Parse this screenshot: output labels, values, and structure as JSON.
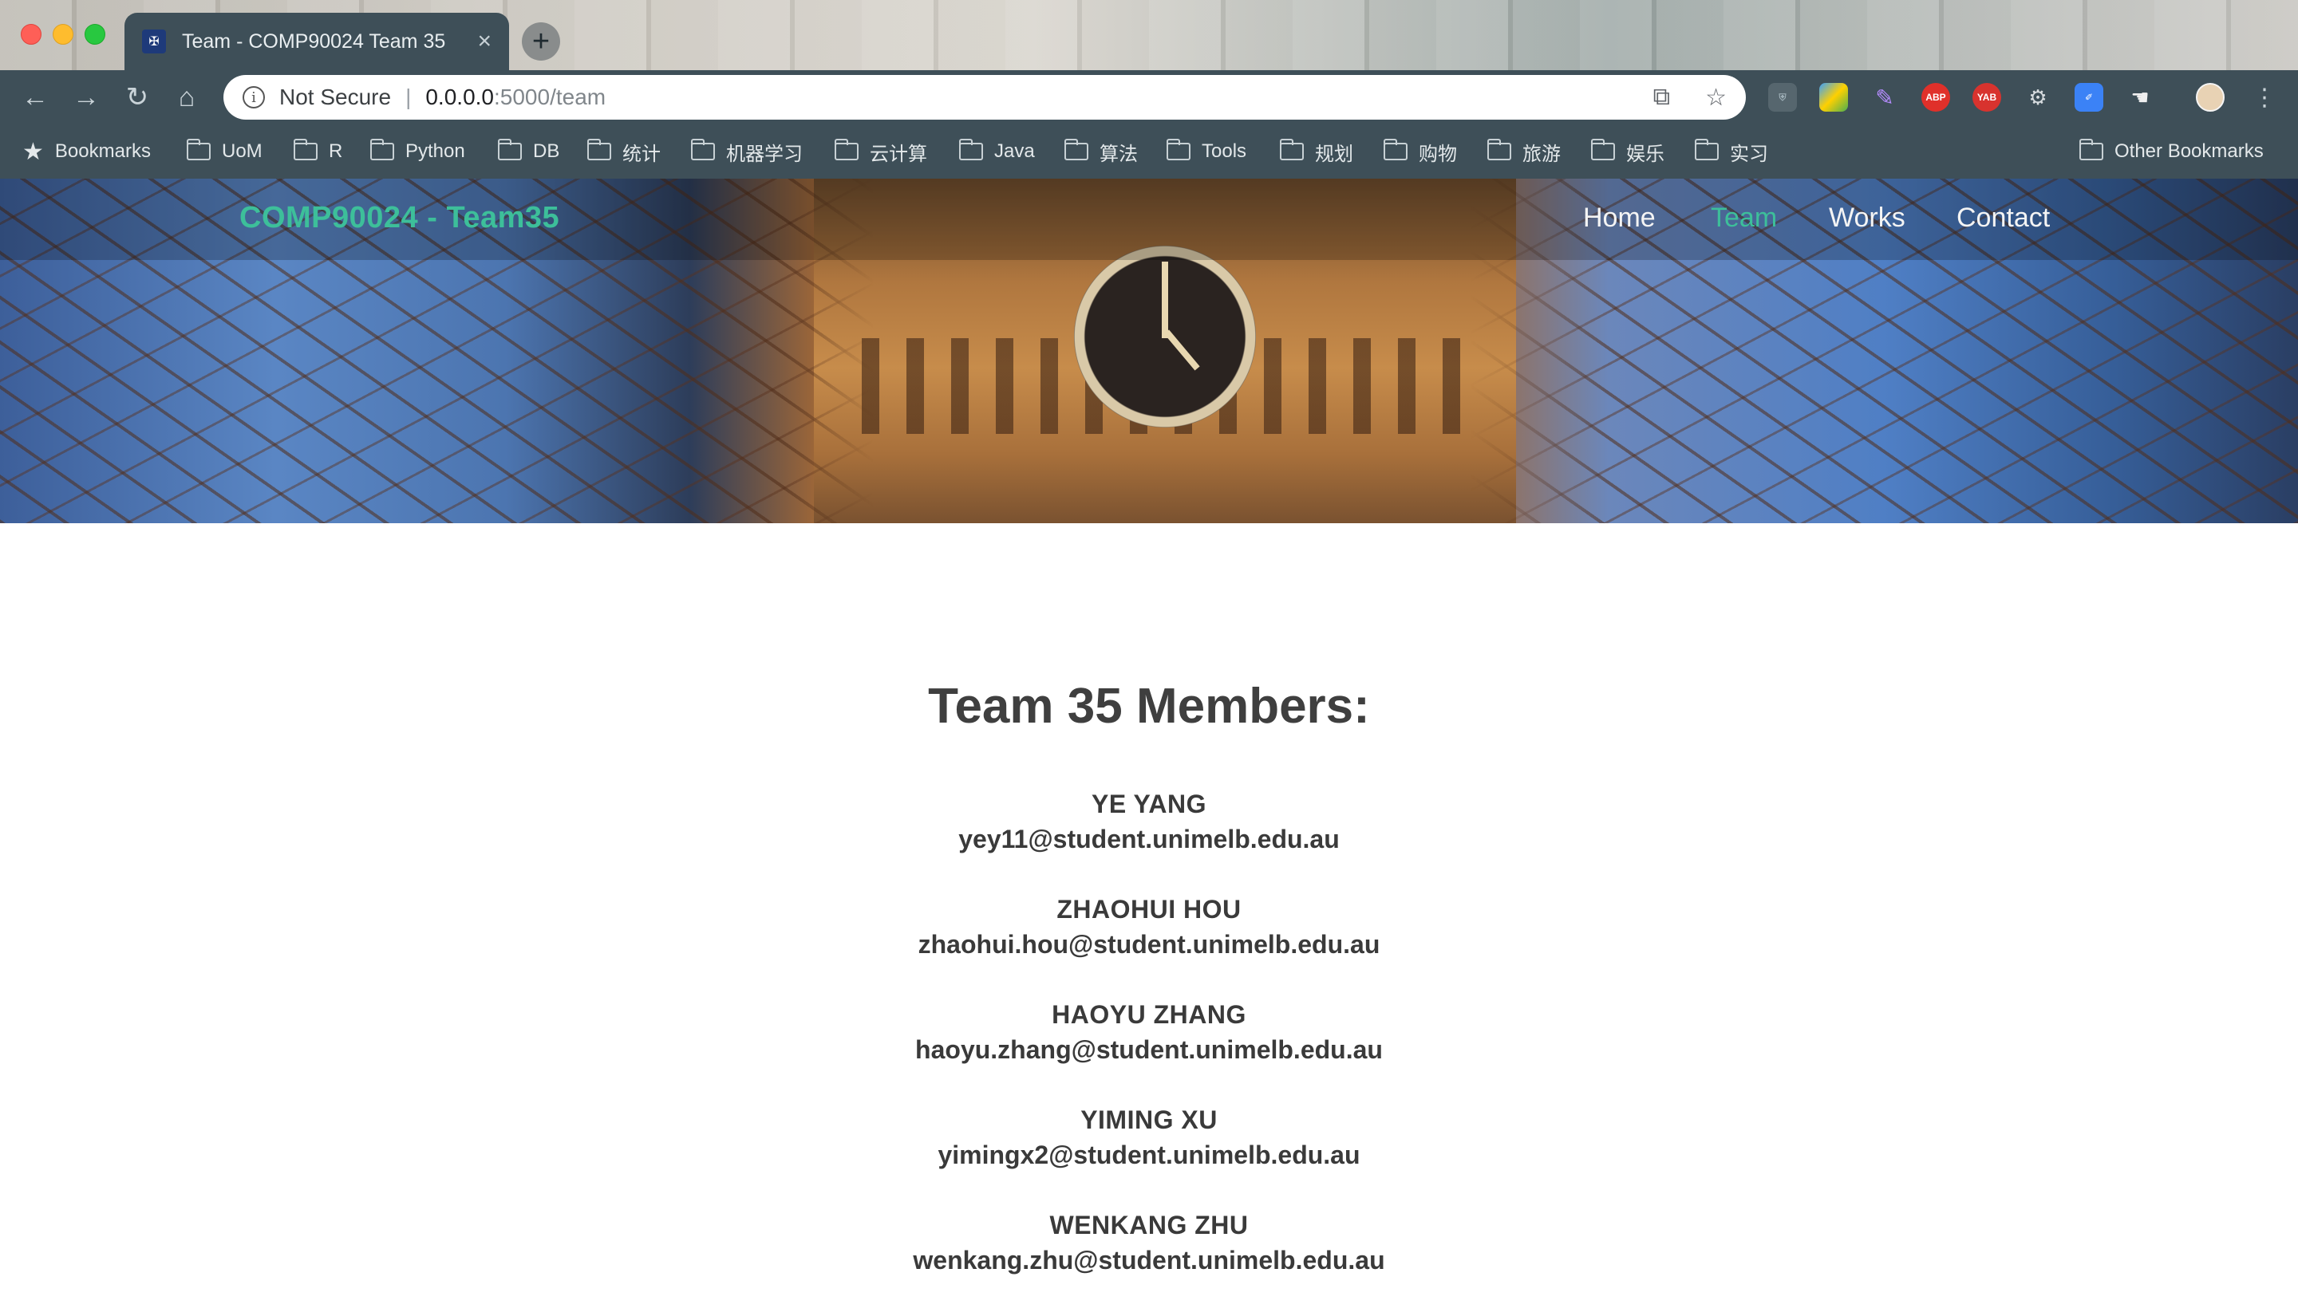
{
  "browser": {
    "tab_title": "Team - COMP90024 Team 35",
    "tab_favicon": "university-crest-icon",
    "url_security": "Not Secure",
    "url_host": "0.0.0.0",
    "url_path": ":5000/team",
    "extensions": [
      {
        "name": "shield-extension-icon",
        "label": ""
      },
      {
        "name": "colorful-extension-icon",
        "label": ""
      },
      {
        "name": "feather-extension-icon",
        "label": ""
      },
      {
        "name": "adblock-plus-icon",
        "label": "ABP"
      },
      {
        "name": "yab-extension-icon",
        "label": "YAB"
      },
      {
        "name": "translate-extension-icon",
        "label": ""
      },
      {
        "name": "blue-pen-extension-icon",
        "label": ""
      },
      {
        "name": "hand-extension-icon",
        "label": ""
      }
    ],
    "bookmarks": {
      "root_label": "Bookmarks",
      "folders": [
        "UoM",
        "R",
        "Python",
        "DB",
        "统计",
        "机器学习",
        "云计算",
        "Java",
        "算法",
        "Tools",
        "规划",
        "购物",
        "旅游",
        "娱乐",
        "实习"
      ],
      "other": "Other Bookmarks"
    }
  },
  "site": {
    "brand": "COMP90024 - Team35",
    "nav": [
      {
        "label": "Home",
        "active": false
      },
      {
        "label": "Team",
        "active": true
      },
      {
        "label": "Works",
        "active": false
      },
      {
        "label": "Contact",
        "active": false
      }
    ],
    "accent_color": "#3dbf9a"
  },
  "main": {
    "heading": "Team 35 Members:",
    "members": [
      {
        "name": "YE YANG",
        "email": "yey11@student.unimelb.edu.au"
      },
      {
        "name": "ZHAOHUI HOU",
        "email": "zhaohui.hou@student.unimelb.edu.au"
      },
      {
        "name": "HAOYU ZHANG",
        "email": "haoyu.zhang@student.unimelb.edu.au"
      },
      {
        "name": "YIMING XU",
        "email": "yimingx2@student.unimelb.edu.au"
      },
      {
        "name": "WENKANG ZHU",
        "email": "wenkang.zhu@student.unimelb.edu.au"
      }
    ]
  }
}
